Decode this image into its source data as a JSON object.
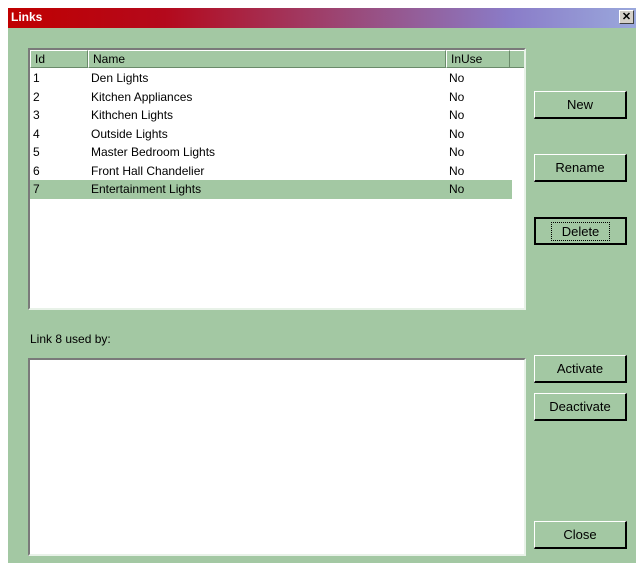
{
  "window": {
    "title": "Links",
    "close_glyph": "✕"
  },
  "links_list": {
    "columns": [
      "Id",
      "Name",
      "InUse"
    ],
    "rows": [
      {
        "id": "1",
        "name": "Den Lights",
        "inuse": "No"
      },
      {
        "id": "2",
        "name": "Kitchen Appliances",
        "inuse": "No"
      },
      {
        "id": "3",
        "name": "Kithchen Lights",
        "inuse": "No"
      },
      {
        "id": "4",
        "name": "Outside Lights",
        "inuse": "No"
      },
      {
        "id": "5",
        "name": "Master Bedroom Lights",
        "inuse": "No"
      },
      {
        "id": "6",
        "name": "Front Hall Chandelier",
        "inuse": "No"
      },
      {
        "id": "7",
        "name": "Entertainment Lights",
        "inuse": "No"
      }
    ],
    "selected_row": "7"
  },
  "used_by": {
    "label": "Link 8 used by:"
  },
  "buttons": {
    "new": "New",
    "rename": "Rename",
    "delete": "Delete",
    "activate": "Activate",
    "deactivate": "Deactivate",
    "close": "Close"
  },
  "colors": {
    "dialog_bg": "#a3c8a3",
    "title_start": "#c00000",
    "title_end": "#9aa8dc",
    "selection": "#a3c8a3"
  }
}
